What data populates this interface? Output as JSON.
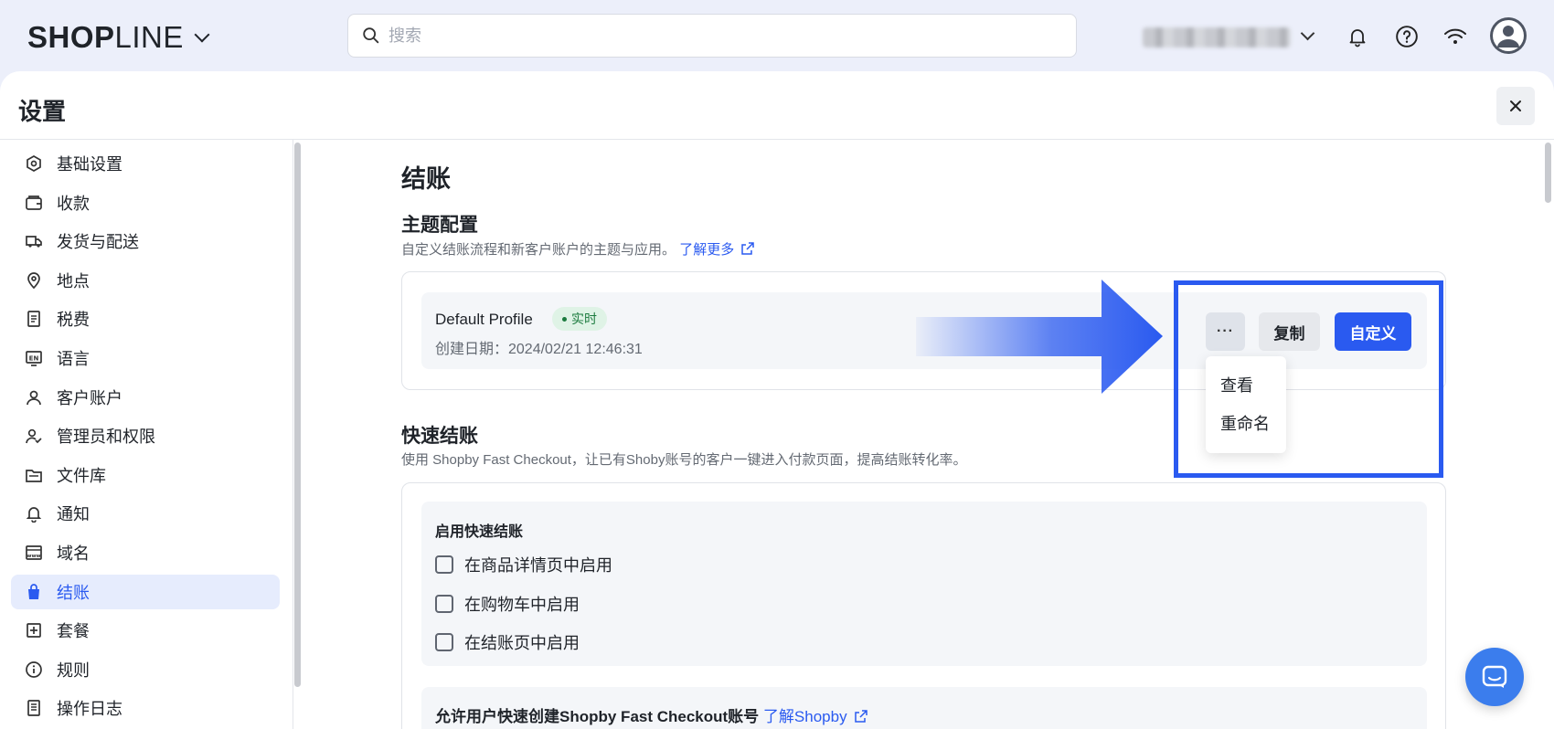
{
  "header": {
    "logo_bold": "SHOP",
    "logo_thin": "LINE",
    "search_placeholder": "搜索"
  },
  "panel": {
    "title": "设置"
  },
  "sidebar": {
    "items": [
      {
        "label": "基础设置",
        "icon": "settings-icon"
      },
      {
        "label": "收款",
        "icon": "wallet-icon"
      },
      {
        "label": "发货与配送",
        "icon": "truck-icon"
      },
      {
        "label": "地点",
        "icon": "location-icon"
      },
      {
        "label": "税费",
        "icon": "receipt-icon"
      },
      {
        "label": "语言",
        "icon": "language-icon"
      },
      {
        "label": "客户账户",
        "icon": "user-icon"
      },
      {
        "label": "管理员和权限",
        "icon": "admin-icon"
      },
      {
        "label": "文件库",
        "icon": "folder-icon"
      },
      {
        "label": "通知",
        "icon": "bell-icon"
      },
      {
        "label": "域名",
        "icon": "domain-icon"
      },
      {
        "label": "结账",
        "icon": "bag-icon",
        "active": true
      },
      {
        "label": "套餐",
        "icon": "plan-icon"
      },
      {
        "label": "规则",
        "icon": "info-icon"
      },
      {
        "label": "操作日志",
        "icon": "log-icon"
      }
    ]
  },
  "main": {
    "title": "结账",
    "theme": {
      "title": "主题配置",
      "desc": "自定义结账流程和新客户账户的主题与应用。",
      "learn_more": "了解更多",
      "profile_name": "Default Profile",
      "badge": "实时",
      "created": "创建日期：2024/02/21 12:46:31",
      "more_label": "···",
      "copy_label": "复制",
      "customize_label": "自定义",
      "menu": [
        "查看",
        "重命名"
      ]
    },
    "fast": {
      "title": "快速结账",
      "desc": "使用 Shopby Fast Checkout，让已有Shoby账号的客户一键进入付款页面，提高结账转化率。",
      "group_title": "启用快速结账",
      "options": [
        "在商品详情页中启用",
        "在购物车中启用",
        "在结账页中启用"
      ],
      "allow_text": "允许用户快速创建Shopby Fast Checkout账号",
      "allow_link": "了解Shopby"
    }
  },
  "colors": {
    "accent": "#2a5af0",
    "badge_bg": "#dff3e6",
    "badge_text": "#1b7b3e"
  }
}
